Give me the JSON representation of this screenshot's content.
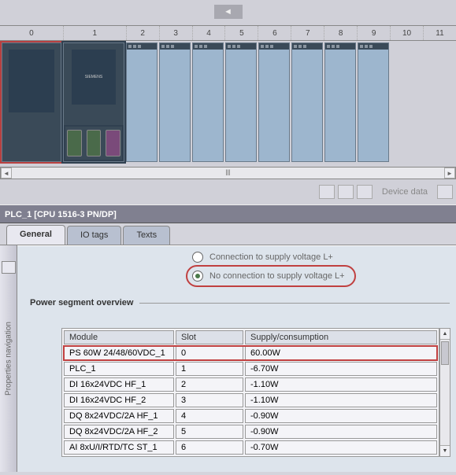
{
  "rack": {
    "slots": [
      "0",
      "1",
      "2",
      "3",
      "4",
      "5",
      "6",
      "7",
      "8",
      "9",
      "10",
      "11"
    ],
    "cpu_text": "SIEMENS"
  },
  "footer": {
    "device_data": "Device data"
  },
  "title": "PLC_1 [CPU 1516-3 PN/DP]",
  "tabs": {
    "general": "General",
    "io_tags": "IO tags",
    "texts": "Texts"
  },
  "side": {
    "label": "Properties navigation"
  },
  "radios": {
    "opt1": "Connection to supply voltage L+",
    "opt2": "No connection to supply voltage L+"
  },
  "section": {
    "title": "Power segment overview"
  },
  "table": {
    "headers": {
      "module": "Module",
      "slot": "Slot",
      "supply": "Supply/consumption"
    },
    "rows": [
      {
        "module": "PS 60W 24/48/60VDC_1",
        "slot": "0",
        "supply": "60.00W",
        "highlight": true
      },
      {
        "module": "PLC_1",
        "slot": "1",
        "supply": "-6.70W"
      },
      {
        "module": "DI 16x24VDC HF_1",
        "slot": "2",
        "supply": "-1.10W"
      },
      {
        "module": "DI 16x24VDC HF_2",
        "slot": "3",
        "supply": "-1.10W"
      },
      {
        "module": "DQ 8x24VDC/2A HF_1",
        "slot": "4",
        "supply": "-0.90W"
      },
      {
        "module": "DQ 8x24VDC/2A HF_2",
        "slot": "5",
        "supply": "-0.90W"
      },
      {
        "module": "AI 8xU/I/RTD/TC ST_1",
        "slot": "6",
        "supply": "-0.70W"
      }
    ]
  }
}
